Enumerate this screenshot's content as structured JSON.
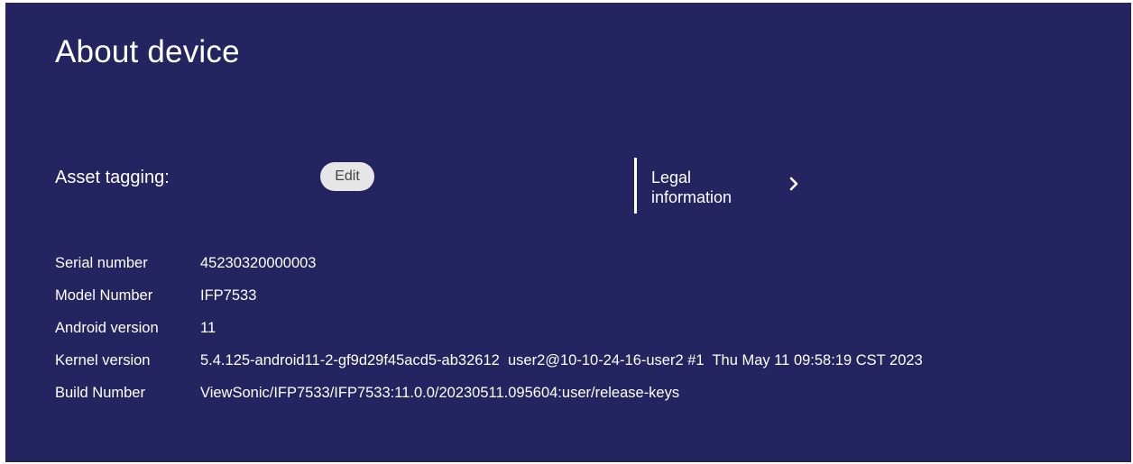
{
  "page": {
    "title": "About device"
  },
  "asset_tagging": {
    "label": "Asset tagging:",
    "edit_label": "Edit"
  },
  "legal": {
    "label": "Legal information",
    "icon": "chevron-right-icon"
  },
  "info": [
    {
      "key": "Serial number",
      "value": "45230320000003"
    },
    {
      "key": "Model Number",
      "value": "IFP7533"
    },
    {
      "key": "Android version",
      "value": "11"
    },
    {
      "key": "Kernel version",
      "value": "5.4.125-android11-2-gf9d29f45acd5-ab32612  user2@10-10-24-16-user2 #1  Thu May 11 09:58:19 CST 2023"
    },
    {
      "key": "Build Number",
      "value": "ViewSonic/IFP7533/IFP7533:11.0.0/20230511.095604:user/release-keys"
    }
  ],
  "colors": {
    "background": "#242460",
    "text": "#ffffff",
    "button_bg": "#e6e6e6"
  }
}
